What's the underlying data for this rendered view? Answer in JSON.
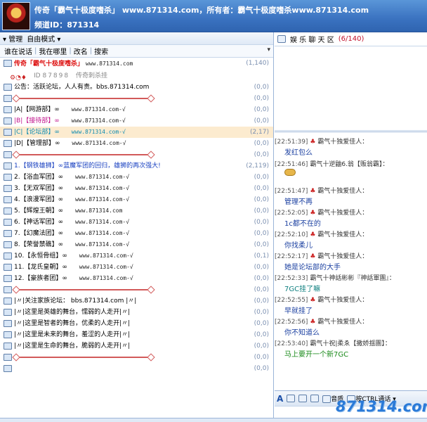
{
  "header": {
    "title": "传奇「霸气十极度嗜杀」 www.871314.com，所有者：霸气十极度嗜杀www.871314.com",
    "channel_id": "频道ID：871314"
  },
  "toolbar": {
    "manage": "管理",
    "mode": "自由模式"
  },
  "tabs": {
    "t1": "谁在说话",
    "t2": "我在哪里",
    "t3": "改名",
    "t4": "搜索"
  },
  "channel": {
    "name": "传奇「霸气十极度嗜杀」",
    "url": "www.871314.com",
    "count": "(1,140)",
    "id_label": "ID",
    "id_value": "87898",
    "nick": "传奇刺杀挂"
  },
  "notice": {
    "text": "公告：活跃论坛，人人有责。bbs.871314.com",
    "count": "(0,0)"
  },
  "rows": [
    {
      "label": "|A|【网游部】∞",
      "url": "www.871314.com-√",
      "count": "(0,0)"
    },
    {
      "label": "|B|【接待部】∞",
      "url": "www.871314.com-√",
      "count": "(0,0)"
    },
    {
      "label": "|C|【论坛部】∞",
      "url": "www.871314.com-√",
      "count": "(2,17)"
    },
    {
      "label": "|D|【管理部】∞",
      "url": "www.871314.com-√",
      "count": "(0,0)"
    },
    {
      "label": "1.【钢铁雄狮】∞蓝魔军团的回归，雄狮的再次强大!",
      "url": "",
      "count": "(2,119)"
    },
    {
      "label": "2.【浴血军团】∞",
      "url": "www.871314.com-√",
      "count": "(0,0)"
    },
    {
      "label": "3.【无双军团】∞",
      "url": "www.871314.com-√",
      "count": "(0,0)"
    },
    {
      "label": "4.【浪漫军团】∞",
      "url": "www.871314.com-√",
      "count": "(0,0)"
    },
    {
      "label": "5.【辉煌王朝】∞",
      "url": "www.871314.com",
      "count": "(0,0)"
    },
    {
      "label": "6.【神话军团】∞",
      "url": "www.871314.com-√",
      "count": "(0,0)"
    },
    {
      "label": "7.【幻魔法团】∞",
      "url": "www.871314.com-√",
      "count": "(0,0)"
    },
    {
      "label": "8.【荣誉禁礁】∞",
      "url": "www.871314.com-√",
      "count": "(0,0)"
    },
    {
      "label": "10.【永恒骨组】∞",
      "url": "www.871314.com-√",
      "count": "(0,1)"
    },
    {
      "label": "11.【龙氏皇朝】∞",
      "url": "www.871314.com-√",
      "count": "(0,0)"
    },
    {
      "label": "12.【豪族者团】∞",
      "url": "www.871314.com-√",
      "count": "(0,0)"
    },
    {
      "label": "|〃|关注家族论坛： bbs.871314.com |〃|",
      "url": "",
      "count": "(0,0)"
    },
    {
      "label": "|〃|这里是英雄的舞台，懦弱的人走开|〃|",
      "url": "",
      "count": "(0,0)"
    },
    {
      "label": "|〃|这里是智者的舞台，优柔的人走开|〃|",
      "url": "",
      "count": "(0,0)"
    },
    {
      "label": "|〃|这里是未来的舞台，羞涩的人走开|〃|",
      "url": "",
      "count": "(0,0)"
    },
    {
      "label": "|〃|这里是生命的舞台，脆弱的人走开|〃|",
      "url": "",
      "count": "(0,0)"
    }
  ],
  "sep_counts": [
    "(0,0)",
    "(0,0)",
    "(0,0)",
    "(0,0)",
    "(0,0)"
  ],
  "room": {
    "name": "娱 乐 聊 天 区",
    "count": "(6/140)"
  },
  "messages": [
    {
      "time": "[22:51:39]",
      "user": "霸气十独爱佳人：",
      "text": "发红包么"
    },
    {
      "time": "[22:51:46]",
      "user": "霸气十逆鼬6.翁【贩翁霸】：",
      "text": ""
    },
    {
      "time": "[22:51:47]",
      "user": "霸气十独爱佳人：",
      "text": "管理不再"
    },
    {
      "time": "[22:52:05]",
      "user": "霸气十独爱佳人：",
      "text": "1c都不在的"
    },
    {
      "time": "[22:52:10]",
      "user": "霸气十独爱佳人：",
      "text": "你找柔儿"
    },
    {
      "time": "[22:52:17]",
      "user": "霸气十独爱佳人：",
      "text": "她是论坛部的大手"
    },
    {
      "time": "[22:52:33]",
      "user": "霸气十神話彬彬『神話軍團』：",
      "text": "7GC挂了嘛"
    },
    {
      "time": "[22:52:55]",
      "user": "霸气十独爱佳人：",
      "text": "早就挂了"
    },
    {
      "time": "[22:52:56]",
      "user": "霸气十独爱佳人：",
      "text": "你不知道么"
    },
    {
      "time": "[22:53:40]",
      "user": "霸气十祝|柔ゑ【撒娇揺團】：",
      "text": "马上要开一个新7GC"
    }
  ],
  "input": {
    "sound": "音质",
    "ctrl": "按CTRL通话"
  },
  "watermark": "871314.com"
}
